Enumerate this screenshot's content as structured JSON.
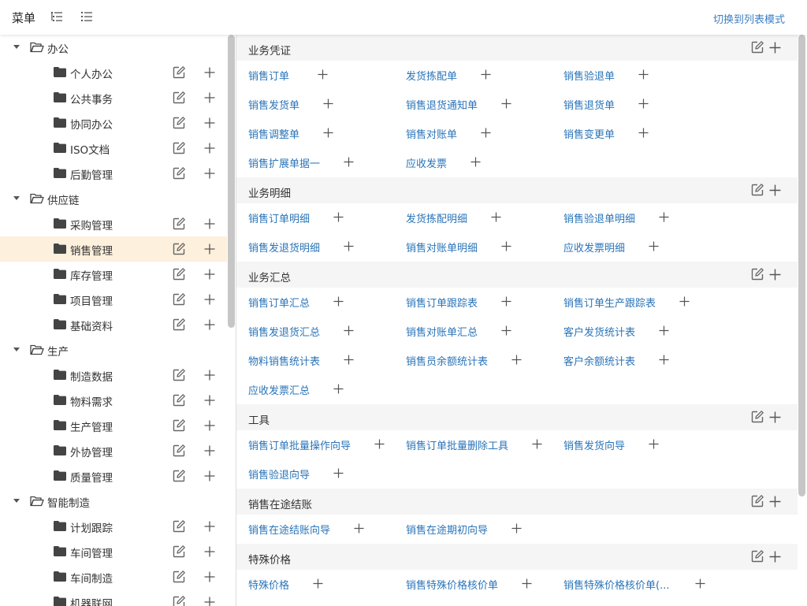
{
  "header": {
    "title": "菜单",
    "switch_label": "切换到列表模式"
  },
  "sidebar": {
    "groups": [
      {
        "label": "办公",
        "items": [
          "个人办公",
          "公共事务",
          "协同办公",
          "ISO文档",
          "后勤管理"
        ]
      },
      {
        "label": "供应链",
        "items": [
          "采购管理",
          "销售管理",
          "库存管理",
          "项目管理",
          "基础资料"
        ]
      },
      {
        "label": "生产",
        "items": [
          "制造数据",
          "物料需求",
          "生产管理",
          "外协管理",
          "质量管理"
        ]
      },
      {
        "label": "智能制造",
        "items": [
          "计划跟踪",
          "车间管理",
          "车间制造",
          "机器联网"
        ]
      }
    ],
    "selected": "销售管理"
  },
  "sections": [
    {
      "title": "业务凭证",
      "items": [
        "销售订单",
        "发货拣配单",
        "销售验退单",
        "销售发货单",
        "销售退货通知单",
        "销售退货单",
        "销售调整单",
        "销售对账单",
        "销售变更单",
        "销售扩展单据一",
        "应收发票"
      ]
    },
    {
      "title": "业务明细",
      "items": [
        "销售订单明细",
        "发货拣配明细",
        "销售验退单明细",
        "销售发退货明细",
        "销售对账单明细",
        "应收发票明细"
      ]
    },
    {
      "title": "业务汇总",
      "items": [
        "销售订单汇总",
        "销售订单跟踪表",
        "销售订单生产跟踪表",
        "销售发退货汇总",
        "销售对账单汇总",
        "客户发货统计表",
        "物料销售统计表",
        "销售员余额统计表",
        "客户余额统计表",
        "应收发票汇总"
      ]
    },
    {
      "title": "工具",
      "items": [
        "销售订单批量操作向导",
        "销售订单批量删除工具",
        "销售发货向导",
        "销售验退向导"
      ]
    },
    {
      "title": "销售在途结账",
      "items": [
        "销售在途结账向导",
        "销售在途期初向导"
      ]
    },
    {
      "title": "特殊价格",
      "items": [
        "特殊价格",
        "销售特殊价格核价单",
        "销售特殊价格核价单(..."
      ]
    }
  ],
  "colors": {
    "link": "#2a74b8",
    "selected_row": "#fdf0dd",
    "section_bg": "#f5f5f5"
  },
  "icons": {
    "edit": "edit-icon",
    "add": "plus-icon",
    "folder_open": "folder-open-icon",
    "folder": "folder-icon"
  }
}
